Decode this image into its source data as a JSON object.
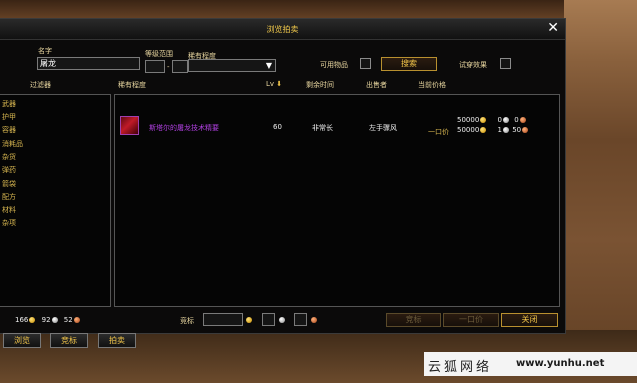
{
  "window": {
    "title": "浏览拍卖",
    "close_glyph": "✕"
  },
  "search": {
    "name_label": "名字",
    "name_value": "屠龙",
    "level_label": "等级范围",
    "level_dash": "-",
    "rarity_label": "稀有程度",
    "usable_label": "可用物品",
    "search_button": "搜索",
    "try_label": "试穿效果"
  },
  "filters": {
    "header": "过滤器",
    "items": [
      "武器",
      "护甲",
      "容器",
      "消耗品",
      "杂货",
      "弹药",
      "箭袋",
      "配方",
      "材料",
      "杂项"
    ]
  },
  "columns": {
    "rarity": "稀有程度",
    "level": "Lv",
    "time_left": "剩余时间",
    "seller": "出售者",
    "current_price": "当前价格"
  },
  "results": [
    {
      "name": "斯塔尔的屠龙技术精要",
      "level": "60",
      "time_left": "非常长",
      "seller": "左手骤风",
      "bid_gold": "50000",
      "bid_silver": "0",
      "bid_copper": "0",
      "buyout_label": "一口价",
      "buyout_gold": "50000",
      "buyout_silver": "1",
      "buyout_copper": "50"
    }
  ],
  "footer": {
    "money_gold": "166",
    "money_silver": "92",
    "money_copper": "52",
    "bid_label": "竞标",
    "bid_button": "竞标",
    "buyout_button": "一口价",
    "close_button": "关闭"
  },
  "tabs": [
    "浏览",
    "竞标",
    "拍卖"
  ],
  "watermark": {
    "text": "云狐网络",
    "url": "www.yunhu.net"
  }
}
